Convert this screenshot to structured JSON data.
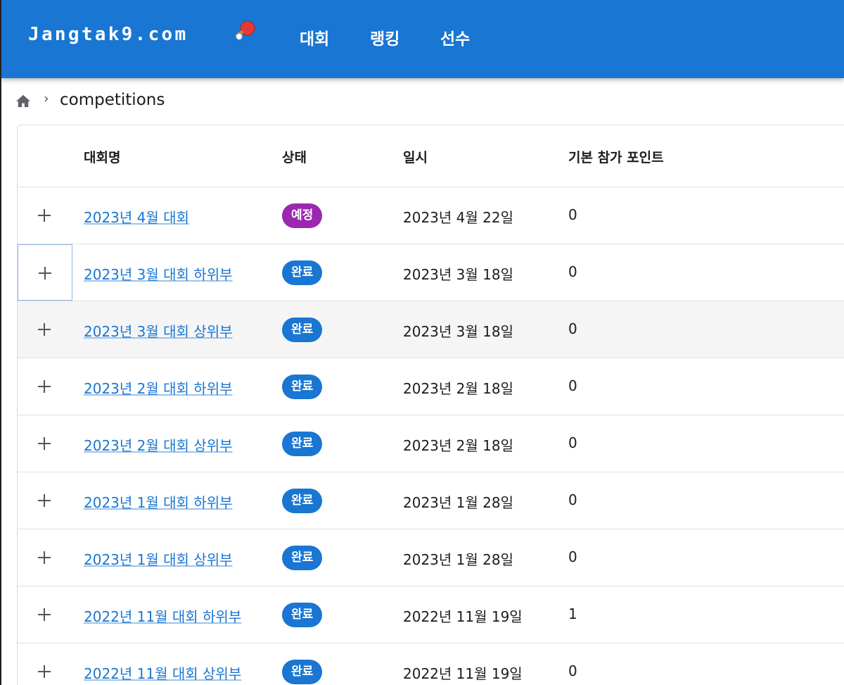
{
  "app": {
    "brand": "Jangtak9.com"
  },
  "nav": {
    "items": [
      "대회",
      "랭킹",
      "선수"
    ]
  },
  "breadcrumb": {
    "separator": "›",
    "current": "competitions"
  },
  "table": {
    "headers": {
      "name": "대회명",
      "status": "상태",
      "date": "일시",
      "points": "기본 참가 포인트"
    },
    "rows": [
      {
        "name": "2023년 4월 대회",
        "status": "예정",
        "status_color": "#9c27b0",
        "date": "2023년 4월 22일",
        "points": "0"
      },
      {
        "name": "2023년 3월 대회 하위부",
        "status": "완료",
        "status_color": "#1976d2",
        "date": "2023년 3월 18일",
        "points": "0"
      },
      {
        "name": "2023년 3월 대회 상위부",
        "status": "완료",
        "status_color": "#1976d2",
        "date": "2023년 3월 18일",
        "points": "0"
      },
      {
        "name": "2023년 2월 대회 하위부",
        "status": "완료",
        "status_color": "#1976d2",
        "date": "2023년 2월 18일",
        "points": "0"
      },
      {
        "name": "2023년 2월 대회 상위부",
        "status": "완료",
        "status_color": "#1976d2",
        "date": "2023년 2월 18일",
        "points": "0"
      },
      {
        "name": "2023년 1월 대회 하위부",
        "status": "완료",
        "status_color": "#1976d2",
        "date": "2023년 1월 28일",
        "points": "0"
      },
      {
        "name": "2023년 1월 대회 상위부",
        "status": "완료",
        "status_color": "#1976d2",
        "date": "2023년 1월 28일",
        "points": "0"
      },
      {
        "name": "2022년 11월 대회 하위부",
        "status": "완료",
        "status_color": "#1976d2",
        "date": "2022년 11월 19일",
        "points": "1"
      },
      {
        "name": "2022년 11월 대회 상위부",
        "status": "완료",
        "status_color": "#1976d2",
        "date": "2022년 11월 19일",
        "points": "0"
      }
    ]
  },
  "colors": {
    "appbar": "#1976d2",
    "link": "#1976d2",
    "upcoming": "#9c27b0",
    "completed": "#1976d2",
    "hover_row": "#f5f5f5"
  },
  "icons": {
    "brand_icon": "ping-pong-paddle-icon",
    "home": "home-icon",
    "expand": "plus-icon"
  }
}
